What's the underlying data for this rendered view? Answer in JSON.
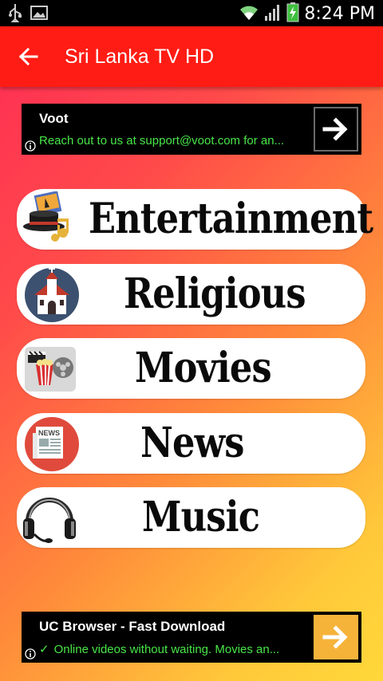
{
  "status_bar": {
    "time": "8:24 PM",
    "icons": [
      "usb-icon",
      "image-icon",
      "wifi-icon",
      "signal-icon",
      "battery-icon"
    ]
  },
  "app_bar": {
    "title": "Sri Lanka TV HD",
    "back_icon": "arrow-back-icon"
  },
  "ads": [
    {
      "title": "Voot",
      "description": "Reach out to us at support@voot.com for an...",
      "action_icon": "arrow-right-icon"
    },
    {
      "title": "UC Browser - Fast Download",
      "description": "Online videos without waiting. Movies an...",
      "action_icon": "arrow-right-icon"
    }
  ],
  "categories": [
    {
      "label": "Entertainment",
      "icon": "entertainment-icon"
    },
    {
      "label": "Religious",
      "icon": "church-icon"
    },
    {
      "label": "Movies",
      "icon": "movies-icon"
    },
    {
      "label": "News",
      "icon": "news-icon"
    },
    {
      "label": "Music",
      "icon": "headphones-icon"
    }
  ],
  "colors": {
    "app_bar": "#ff1c14",
    "ad_background": "#000000",
    "ad_description": "#48e648",
    "ad_cta_bottom": "#f6b33a"
  }
}
